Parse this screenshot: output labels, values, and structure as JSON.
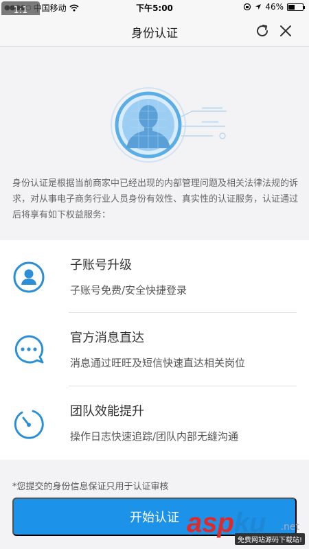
{
  "status_bar": {
    "carrier": "中国移动",
    "time": "下午5:00",
    "battery_percent": "46%",
    "battery_level": 0.46,
    "zoom_badge": "1:1",
    "icons": [
      "signal-dots-icon",
      "wifi-icon",
      "rotation-lock-icon",
      "location-arrow-icon",
      "battery-icon"
    ]
  },
  "nav": {
    "title": "身份认证",
    "icons": [
      "refresh-icon",
      "close-icon"
    ]
  },
  "hero": {
    "intro": "身份认证是根据当前商家中已经出现的内部管理问题及相关法律法规的诉求，对从事电子商务行业人员身份有效性、真实性的认证服务，认证通过后将享有如下权益服务："
  },
  "features": [
    {
      "title": "子账号升级",
      "desc": "子账号免费/安全快捷登录",
      "icon": "user-icon"
    },
    {
      "title": "官方消息直达",
      "desc": "消息通过旺旺及短信快速直达相关岗位",
      "icon": "chat-bubble-icon"
    },
    {
      "title": "团队效能提升",
      "desc": "操作日志快速追踪/团队内部无缝沟通",
      "icon": "stopwatch-icon"
    }
  ],
  "footer": {
    "notice": "*您提交的身份信息保证只用于认证审核",
    "start_button": "开始认证"
  },
  "watermark": {
    "brand_asp": "asp",
    "brand_ku": "ku",
    "net": ".net",
    "sub": "免费网站源码下载站!"
  },
  "colors": {
    "accent": "#1c93e8",
    "icon_blue": "#2a8fd6"
  }
}
